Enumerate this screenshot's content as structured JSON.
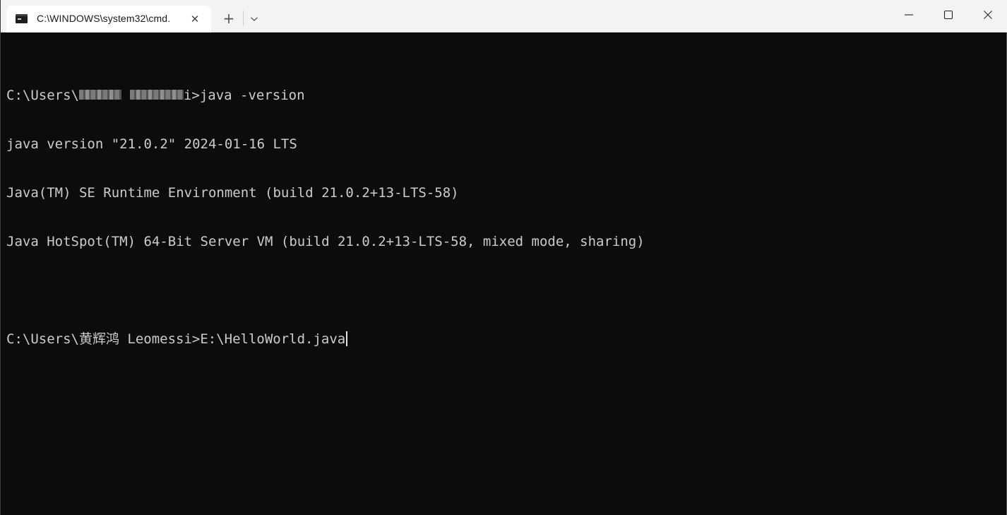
{
  "tab": {
    "title": "C:\\WINDOWS\\system32\\cmd.",
    "close_glyph": "✕",
    "icon": "terminal-icon"
  },
  "toolbar": {
    "new_tab_glyph": "+",
    "dropdown_icon": "chevron-down-icon"
  },
  "window_controls": {
    "minimize_icon": "minimize-icon",
    "maximize_icon": "maximize-icon",
    "close_icon": "close-icon"
  },
  "terminal": {
    "prompt1_prefix": "C:\\Users\\",
    "prompt1_suffix": "i>java -version",
    "output": [
      "java version \"21.0.2\" 2024-01-16 LTS",
      "Java(TM) SE Runtime Environment (build 21.0.2+13-LTS-58)",
      "Java HotSpot(TM) 64-Bit Server VM (build 21.0.2+13-LTS-58, mixed mode, sharing)"
    ],
    "prompt2": "C:\\Users\\黄辉鸿 Leomessi>E:\\HelloWorld.java"
  },
  "colors": {
    "background": "#0c0c0c",
    "foreground": "#cccccc",
    "titlebar": "#f3f3f3",
    "tab_active": "#ffffff"
  }
}
